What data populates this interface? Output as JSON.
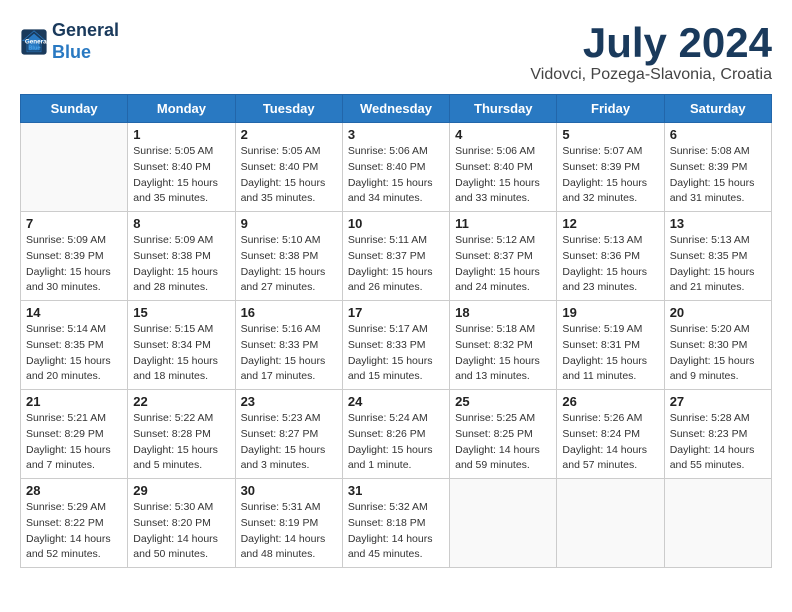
{
  "header": {
    "logo_line1": "General",
    "logo_line2": "Blue",
    "month": "July 2024",
    "location": "Vidovci, Pozega-Slavonia, Croatia"
  },
  "weekdays": [
    "Sunday",
    "Monday",
    "Tuesday",
    "Wednesday",
    "Thursday",
    "Friday",
    "Saturday"
  ],
  "weeks": [
    [
      {
        "day": "",
        "info": ""
      },
      {
        "day": "1",
        "info": "Sunrise: 5:05 AM\nSunset: 8:40 PM\nDaylight: 15 hours\nand 35 minutes."
      },
      {
        "day": "2",
        "info": "Sunrise: 5:05 AM\nSunset: 8:40 PM\nDaylight: 15 hours\nand 35 minutes."
      },
      {
        "day": "3",
        "info": "Sunrise: 5:06 AM\nSunset: 8:40 PM\nDaylight: 15 hours\nand 34 minutes."
      },
      {
        "day": "4",
        "info": "Sunrise: 5:06 AM\nSunset: 8:40 PM\nDaylight: 15 hours\nand 33 minutes."
      },
      {
        "day": "5",
        "info": "Sunrise: 5:07 AM\nSunset: 8:39 PM\nDaylight: 15 hours\nand 32 minutes."
      },
      {
        "day": "6",
        "info": "Sunrise: 5:08 AM\nSunset: 8:39 PM\nDaylight: 15 hours\nand 31 minutes."
      }
    ],
    [
      {
        "day": "7",
        "info": "Sunrise: 5:09 AM\nSunset: 8:39 PM\nDaylight: 15 hours\nand 30 minutes."
      },
      {
        "day": "8",
        "info": "Sunrise: 5:09 AM\nSunset: 8:38 PM\nDaylight: 15 hours\nand 28 minutes."
      },
      {
        "day": "9",
        "info": "Sunrise: 5:10 AM\nSunset: 8:38 PM\nDaylight: 15 hours\nand 27 minutes."
      },
      {
        "day": "10",
        "info": "Sunrise: 5:11 AM\nSunset: 8:37 PM\nDaylight: 15 hours\nand 26 minutes."
      },
      {
        "day": "11",
        "info": "Sunrise: 5:12 AM\nSunset: 8:37 PM\nDaylight: 15 hours\nand 24 minutes."
      },
      {
        "day": "12",
        "info": "Sunrise: 5:13 AM\nSunset: 8:36 PM\nDaylight: 15 hours\nand 23 minutes."
      },
      {
        "day": "13",
        "info": "Sunrise: 5:13 AM\nSunset: 8:35 PM\nDaylight: 15 hours\nand 21 minutes."
      }
    ],
    [
      {
        "day": "14",
        "info": "Sunrise: 5:14 AM\nSunset: 8:35 PM\nDaylight: 15 hours\nand 20 minutes."
      },
      {
        "day": "15",
        "info": "Sunrise: 5:15 AM\nSunset: 8:34 PM\nDaylight: 15 hours\nand 18 minutes."
      },
      {
        "day": "16",
        "info": "Sunrise: 5:16 AM\nSunset: 8:33 PM\nDaylight: 15 hours\nand 17 minutes."
      },
      {
        "day": "17",
        "info": "Sunrise: 5:17 AM\nSunset: 8:33 PM\nDaylight: 15 hours\nand 15 minutes."
      },
      {
        "day": "18",
        "info": "Sunrise: 5:18 AM\nSunset: 8:32 PM\nDaylight: 15 hours\nand 13 minutes."
      },
      {
        "day": "19",
        "info": "Sunrise: 5:19 AM\nSunset: 8:31 PM\nDaylight: 15 hours\nand 11 minutes."
      },
      {
        "day": "20",
        "info": "Sunrise: 5:20 AM\nSunset: 8:30 PM\nDaylight: 15 hours\nand 9 minutes."
      }
    ],
    [
      {
        "day": "21",
        "info": "Sunrise: 5:21 AM\nSunset: 8:29 PM\nDaylight: 15 hours\nand 7 minutes."
      },
      {
        "day": "22",
        "info": "Sunrise: 5:22 AM\nSunset: 8:28 PM\nDaylight: 15 hours\nand 5 minutes."
      },
      {
        "day": "23",
        "info": "Sunrise: 5:23 AM\nSunset: 8:27 PM\nDaylight: 15 hours\nand 3 minutes."
      },
      {
        "day": "24",
        "info": "Sunrise: 5:24 AM\nSunset: 8:26 PM\nDaylight: 15 hours\nand 1 minute."
      },
      {
        "day": "25",
        "info": "Sunrise: 5:25 AM\nSunset: 8:25 PM\nDaylight: 14 hours\nand 59 minutes."
      },
      {
        "day": "26",
        "info": "Sunrise: 5:26 AM\nSunset: 8:24 PM\nDaylight: 14 hours\nand 57 minutes."
      },
      {
        "day": "27",
        "info": "Sunrise: 5:28 AM\nSunset: 8:23 PM\nDaylight: 14 hours\nand 55 minutes."
      }
    ],
    [
      {
        "day": "28",
        "info": "Sunrise: 5:29 AM\nSunset: 8:22 PM\nDaylight: 14 hours\nand 52 minutes."
      },
      {
        "day": "29",
        "info": "Sunrise: 5:30 AM\nSunset: 8:20 PM\nDaylight: 14 hours\nand 50 minutes."
      },
      {
        "day": "30",
        "info": "Sunrise: 5:31 AM\nSunset: 8:19 PM\nDaylight: 14 hours\nand 48 minutes."
      },
      {
        "day": "31",
        "info": "Sunrise: 5:32 AM\nSunset: 8:18 PM\nDaylight: 14 hours\nand 45 minutes."
      },
      {
        "day": "",
        "info": ""
      },
      {
        "day": "",
        "info": ""
      },
      {
        "day": "",
        "info": ""
      }
    ]
  ]
}
